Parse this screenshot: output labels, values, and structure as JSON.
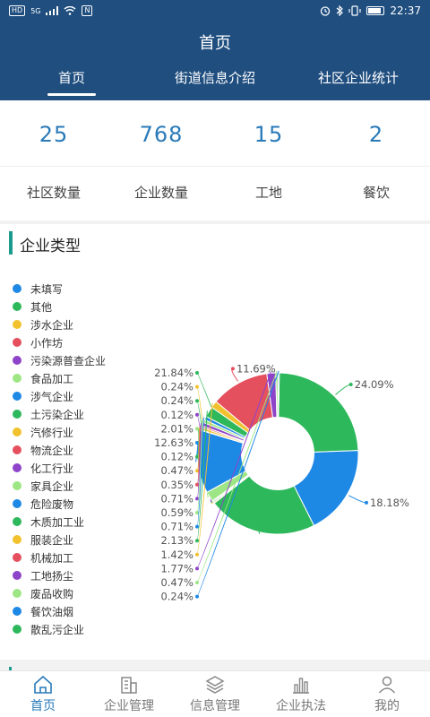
{
  "status_bar": {
    "hd_badge": "HD",
    "network": "5G",
    "nfc": "N",
    "time": "22:37",
    "battery_level": 0.85
  },
  "header": {
    "title": "首页",
    "tabs": [
      {
        "label": "首页",
        "active": true
      },
      {
        "label": "街道信息介绍",
        "active": false
      },
      {
        "label": "社区企业统计",
        "active": false
      }
    ]
  },
  "stats": [
    {
      "value": "25",
      "label": "社区数量"
    },
    {
      "value": "768",
      "label": "企业数量"
    },
    {
      "value": "15",
      "label": "工地"
    },
    {
      "value": "2",
      "label": "餐饮"
    }
  ],
  "card": {
    "title": "企业类型"
  },
  "chart_data": {
    "type": "pie",
    "title": "企业类型",
    "inner_ratio": 0.45,
    "categories": [
      "未填写",
      "其他",
      "涉水企业",
      "小作坊",
      "污染源普查企业",
      "食品加工",
      "涉气企业",
      "土污染企业",
      "汽修行业",
      "物流企业",
      "化工行业",
      "家具企业",
      "危险废物",
      "木质加工业",
      "服装企业",
      "机械加工",
      "工地扬尘",
      "废品收购",
      "餐饮油烟",
      "散乱污企业"
    ],
    "colors": [
      "#1e88e5",
      "#2eb85c",
      "#f2c12e",
      "#e5505f",
      "#8e44c9",
      "#9ee685",
      "#1e88e5",
      "#2eb85c",
      "#f2c12e",
      "#e5505f",
      "#8e44c9",
      "#9ee685",
      "#1e88e5",
      "#2eb85c",
      "#f2c12e",
      "#e5505f",
      "#8e44c9",
      "#9ee685",
      "#1e88e5",
      "#2eb85c"
    ],
    "slices": [
      {
        "value": 24.09,
        "label": "24.09%",
        "color": "#2eb85c"
      },
      {
        "value": 18.18,
        "label": "18.18%",
        "color": "#1e88e5"
      },
      {
        "value": 21.84,
        "label": "21.84%",
        "color": "#2eb85c"
      },
      {
        "value": 0.24,
        "label": "0.24%",
        "color": "#f2c12e"
      },
      {
        "value": 0.24,
        "label": "0.24%",
        "color": "#2eb85c"
      },
      {
        "value": 0.12,
        "label": "0.12%",
        "color": "#8e44c9"
      },
      {
        "value": 2.01,
        "label": "2.01%",
        "color": "#9ee685"
      },
      {
        "value": 12.63,
        "label": "12.63%",
        "color": "#1e88e5"
      },
      {
        "value": 0.12,
        "label": "0.12%",
        "color": "#2eb85c"
      },
      {
        "value": 0.47,
        "label": "0.47%",
        "color": "#f2c12e"
      },
      {
        "value": 0.35,
        "label": "0.35%",
        "color": "#e5505f"
      },
      {
        "value": 0.71,
        "label": "0.71%",
        "color": "#8e44c9"
      },
      {
        "value": 0.59,
        "label": "0.59%",
        "color": "#9ee685"
      },
      {
        "value": 0.71,
        "label": "0.71%",
        "color": "#1e88e5"
      },
      {
        "value": 2.13,
        "label": "2.13%",
        "color": "#2eb85c"
      },
      {
        "value": 1.42,
        "label": "1.42%",
        "color": "#f2c12e"
      },
      {
        "value": 11.69,
        "label": "11.69%",
        "color": "#e5505f"
      },
      {
        "value": 1.77,
        "label": "1.77%",
        "color": "#8e44c9"
      },
      {
        "value": 0.47,
        "label": "0.47%",
        "color": "#9ee685"
      },
      {
        "value": 0.24,
        "label": "0.24%",
        "color": "#1e88e5"
      }
    ]
  },
  "bottom_nav": [
    {
      "label": "首页",
      "icon": "home-icon",
      "active": true
    },
    {
      "label": "企业管理",
      "icon": "building-icon",
      "active": false
    },
    {
      "label": "信息管理",
      "icon": "layers-icon",
      "active": false
    },
    {
      "label": "企业执法",
      "icon": "bar-chart-icon",
      "active": false
    },
    {
      "label": "我的",
      "icon": "user-icon",
      "active": false
    }
  ]
}
